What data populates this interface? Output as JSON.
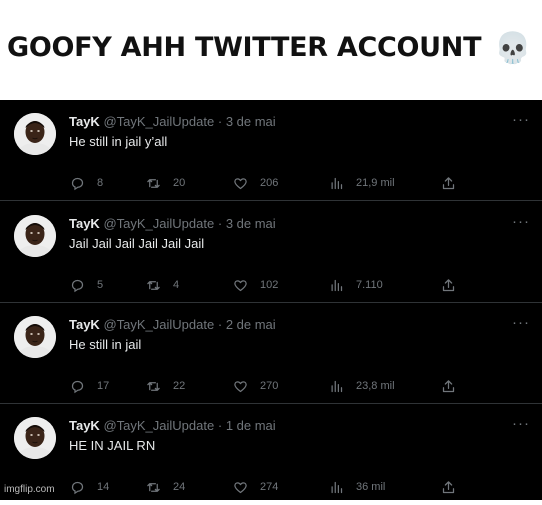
{
  "caption": {
    "text": "GOOFY AHH TWITTER ACCOUNT",
    "emoji_icon": "skull-icon"
  },
  "tweets": [
    {
      "name": "TayK",
      "handle": "@TayK_JailUpdate",
      "date": "3 de mai",
      "text": "He still in jail y’all",
      "replies": "8",
      "retweets": "20",
      "likes": "206",
      "views": "21,9 mil"
    },
    {
      "name": "TayK",
      "handle": "@TayK_JailUpdate",
      "date": "3 de mai",
      "text": "Jail Jail Jail Jail Jail Jail",
      "replies": "5",
      "retweets": "4",
      "likes": "102",
      "views": "7.110"
    },
    {
      "name": "TayK",
      "handle": "@TayK_JailUpdate",
      "date": "2 de mai",
      "text": "He still in jail",
      "replies": "17",
      "retweets": "22",
      "likes": "270",
      "views": "23,8 mil"
    },
    {
      "name": "TayK",
      "handle": "@TayK_JailUpdate",
      "date": "1 de mai",
      "text": "HE IN JAIL RN",
      "replies": "14",
      "retweets": "24",
      "likes": "274",
      "views": "36 mil"
    }
  ],
  "separator": "·",
  "watermark": "imgflip.com",
  "colors": {
    "feed_bg": "#000000",
    "name": "#e7e9ea",
    "secondary": "#71767b",
    "divider": "#2f3336"
  }
}
